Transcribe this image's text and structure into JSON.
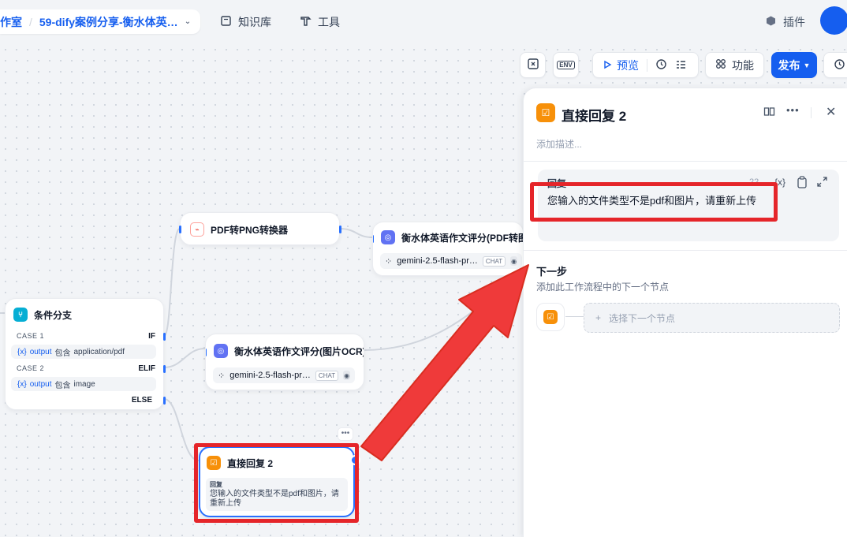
{
  "header": {
    "workspace_partial": "作室",
    "separator": "/",
    "app_name": "59-dify案例分享-衡水体英…",
    "nav_knowledge": "知识库",
    "nav_tools": "工具",
    "nav_plugins": "插件"
  },
  "toolbar": {
    "env_label": "ENV",
    "preview_label": "预览",
    "features_label": "功能",
    "publish_label": "发布"
  },
  "nodes": {
    "pdf_converter": {
      "title": "PDF转PNG转换器"
    },
    "llm_pdf": {
      "title": "衡水体英语作文评分(PDF转图片",
      "model": "gemini-2.5-flash-pr…",
      "badge": "CHAT"
    },
    "if_else": {
      "title": "条件分支",
      "case1_label": "CASE 1",
      "case1_kw": "IF",
      "case1_var": "output",
      "case1_op": "包含",
      "case1_val": "application/pdf",
      "case2_label": "CASE 2",
      "case2_kw": "ELIF",
      "case2_var": "output",
      "case2_op": "包含",
      "case2_val": "image",
      "else_kw": "ELSE",
      "var_prefix": "{x}"
    },
    "llm_ocr": {
      "title": "衡水体英语作文评分(图片OCR)",
      "model": "gemini-2.5-flash-pr…",
      "badge": "CHAT"
    },
    "answer": {
      "title": "直接回复 2",
      "field_label": "回复",
      "text": "您输入的文件类型不是pdf和图片，请重新上传"
    }
  },
  "panel": {
    "title": "直接回复 2",
    "description_placeholder": "添加描述...",
    "answer_label": "回复",
    "answer_count": "22",
    "var_button": "{x}",
    "answer_text": "您输入的文件类型不是pdf和图片，请重新上传",
    "next_step_title": "下一步",
    "next_step_desc": "添加此工作流程中的下一个节点",
    "select_next_placeholder": "选择下一个节点"
  },
  "colors": {
    "primary": "#155eef",
    "answer_node": "#f79009",
    "llm_node": "#6172f3",
    "if_node": "#06aed4",
    "annotation_red": "#e5252a"
  }
}
